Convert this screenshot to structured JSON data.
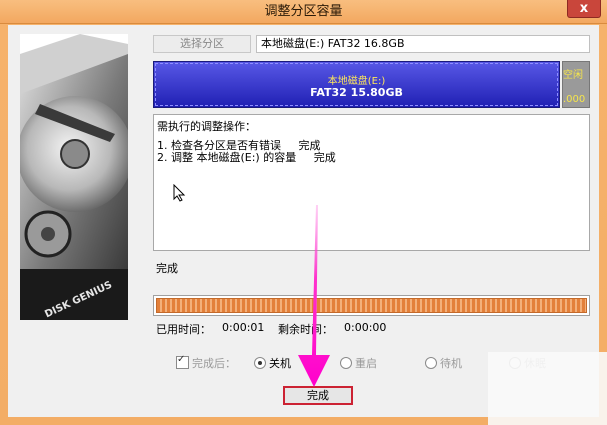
{
  "window": {
    "title": "调整分区容量",
    "close_label": "x"
  },
  "disk_image": {
    "logo_text": "DISK GENIUS"
  },
  "partition": {
    "select_label": "选择分区",
    "selected": "本地磁盘(E:) FAT32 16.8GB",
    "bar_name": "本地磁盘(E:)",
    "bar_size": "FAT32 15.80GB",
    "free_label": "空闲",
    "free_size": ".000"
  },
  "operations": {
    "title": "需执行的调整操作：",
    "items": [
      "1. 检查各分区是否有错误     完成",
      "2. 调整 本地磁盘(E:) 的容量     完成"
    ]
  },
  "status": {
    "text": "完成"
  },
  "progress": {
    "value": 1.0
  },
  "time": {
    "used_label": "已用时间：",
    "used_value": "0:00:01",
    "remaining_label": "剩余时间：",
    "remaining_value": "0:00:00"
  },
  "after_finish": {
    "checkbox_label": "完成后：",
    "checked": true,
    "options": [
      "关机",
      "重启",
      "待机",
      "休眠"
    ],
    "selected": "关机"
  },
  "buttons": {
    "done": "完成"
  },
  "colors": {
    "accent_orange": "#f6b26b",
    "partition_blue": "#2d2dc8",
    "progress_orange": "#e3803a",
    "highlight_red": "#cc2233",
    "arrow_pink": "#ff33cc"
  }
}
